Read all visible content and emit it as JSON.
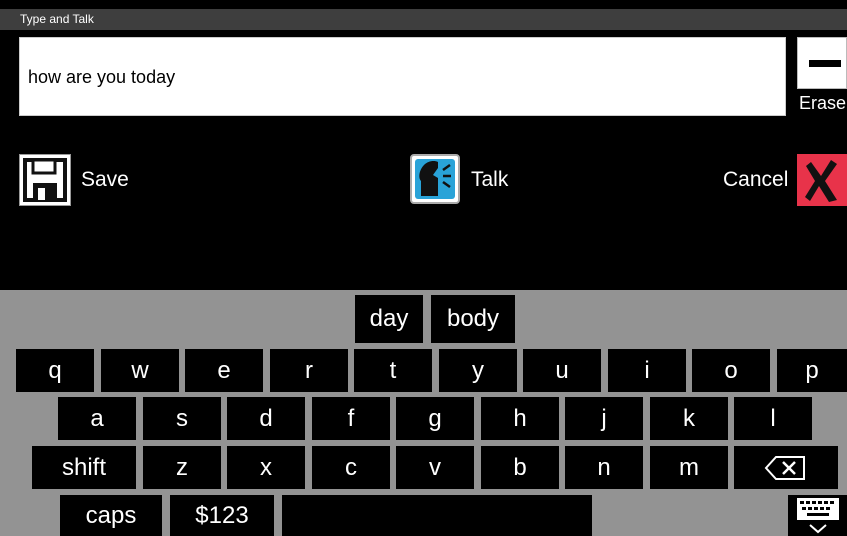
{
  "window": {
    "title": "Type and Talk"
  },
  "text_field": {
    "value": "how are you today"
  },
  "erase": {
    "label": "Erase",
    "icon": "minus-icon"
  },
  "actions": {
    "save_label": "Save",
    "talk_label": "Talk",
    "cancel_label": "Cancel",
    "save_icon": "floppy-disk-icon",
    "talk_icon": "speaking-head-icon",
    "cancel_icon": "red-x-icon"
  },
  "suggestions": [
    "day",
    "body"
  ],
  "keyboard": {
    "row1": [
      "q",
      "w",
      "e",
      "r",
      "t",
      "y",
      "u",
      "i",
      "o",
      "p"
    ],
    "row2": [
      "a",
      "s",
      "d",
      "f",
      "g",
      "h",
      "j",
      "k",
      "l"
    ],
    "row3": [
      "shift",
      "z",
      "x",
      "c",
      "v",
      "b",
      "n",
      "m"
    ],
    "row4": [
      "caps",
      "$123"
    ],
    "backspace_icon": "backspace-icon",
    "hide_keyboard_icon": "keyboard-hide-icon"
  },
  "colors": {
    "background": "#000000",
    "keyboard_background": "#939393",
    "key": "#000000",
    "cancel": "#e8334a",
    "talk_accent": "#29a3d8",
    "title_bar": "#3e3e3e"
  }
}
